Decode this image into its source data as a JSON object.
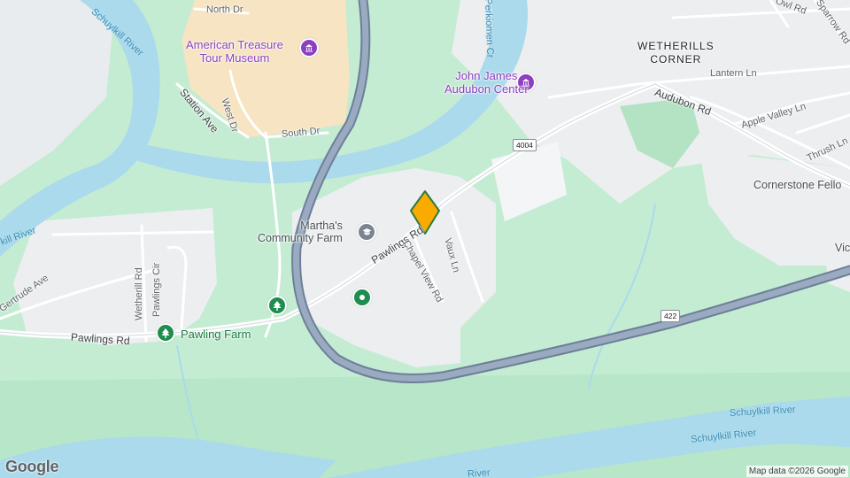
{
  "map": {
    "labels": {
      "museum": "American Treasure\nTour Museum",
      "audubon": "John James\nAudubon Center",
      "wetherills": "WETHERILLS\nCORNER",
      "marthas": "Martha's\nCommunity Farm",
      "pawling_farm": "Pawling Farm",
      "cornerstone": "Cornerstone Fello",
      "vic": "Vic",
      "north_dr": "North Dr",
      "west_dr": "West Dr",
      "south_dr": "South Dr",
      "station_ave": "Station Ave",
      "owl_rd": "Owl Rd",
      "sparrow_rd": "Sparrow Rd",
      "lantern_ln": "Lantern Ln",
      "audubon_rd": "Audubon Rd",
      "apple_valley_ln": "Apple Valley Ln",
      "thrush_ln": "Thrush Ln",
      "pawlings_rd_upper": "Pawlings Rd",
      "chapel_view_rd": "Chapel View Rd",
      "vaux_ln": "Vaux Ln",
      "gertrude_ave": "Gertrude Ave",
      "wetherill_rd": "Wetherill Rd",
      "pawlings_cir": "Pawlings Cir",
      "pawlings_rd_lower": "Pawlings Rd",
      "schuylkill_1": "Schuylkill River",
      "schuylkill_2": "kill River",
      "schuylkill_3": "Schuylkill River",
      "schuylkill_4": "Schuylkill River",
      "schuylkill_5": "River",
      "perkiomen": "Perkiomen Cr"
    },
    "shields": {
      "route_4004": "4004",
      "route_422": "422"
    },
    "icons": {
      "museum": "museum-icon",
      "audubon": "museum-icon",
      "marthas": "education-icon",
      "pawling_farm": "tree-icon",
      "park_pin": "tree-icon",
      "green_pin": "place-icon",
      "selected": "selected-location-marker"
    },
    "colors": {
      "water": "#aadaeb",
      "park": "#c4ecd3",
      "urban": "#e9ecef",
      "highway": "#8b9bb0",
      "poi_purple": "#8e3fbf",
      "poi_green": "#1e8e4f",
      "marker": "#f9ab00"
    },
    "branding": "Google",
    "attribution": "Map data ©2026 Google"
  }
}
